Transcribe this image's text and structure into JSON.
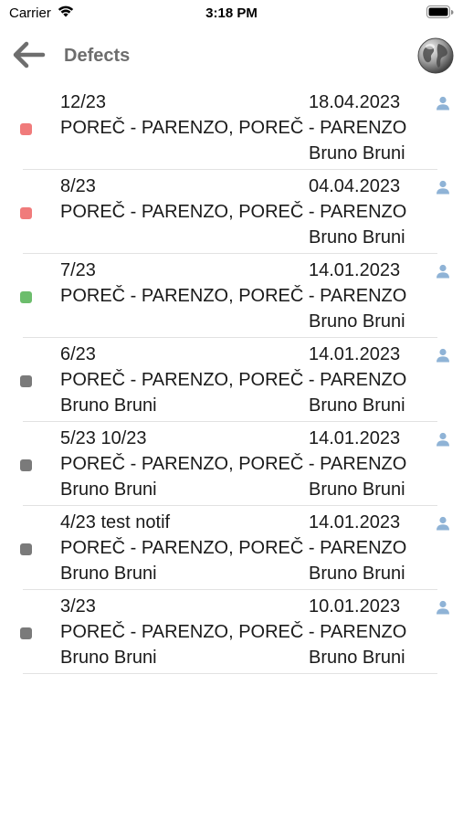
{
  "status_bar": {
    "carrier": "Carrier",
    "time": "3:18 PM"
  },
  "header": {
    "title": "Defects"
  },
  "colors": {
    "red": "#f07b7b",
    "green": "#6cbd6c",
    "gray": "#7a7a7a",
    "user_icon": "#8fb3d6"
  },
  "defects": [
    {
      "number": "12/23",
      "date": "18.04.2023",
      "location": "POREČ - PARENZO, POREČ - PARENZO",
      "left_user": "",
      "right_user": "Bruno Bruni",
      "status": "red"
    },
    {
      "number": "8/23",
      "date": "04.04.2023",
      "location": "POREČ - PARENZO, POREČ - PARENZO",
      "left_user": "",
      "right_user": "Bruno Bruni",
      "status": "red"
    },
    {
      "number": "7/23",
      "date": "14.01.2023",
      "location": "POREČ - PARENZO, POREČ - PARENZO",
      "left_user": "",
      "right_user": "Bruno Bruni",
      "status": "green"
    },
    {
      "number": "6/23",
      "date": "14.01.2023",
      "location": "POREČ - PARENZO, POREČ - PARENZO",
      "left_user": "Bruno Bruni",
      "right_user": "Bruno Bruni",
      "status": "gray"
    },
    {
      "number": "5/23 10/23",
      "date": "14.01.2023",
      "location": "POREČ - PARENZO, POREČ - PARENZO",
      "left_user": "Bruno Bruni",
      "right_user": "Bruno Bruni",
      "status": "gray"
    },
    {
      "number": "4/23 test notif",
      "date": "14.01.2023",
      "location": "POREČ - PARENZO, POREČ - PARENZO",
      "left_user": "Bruno Bruni",
      "right_user": "Bruno Bruni",
      "status": "gray"
    },
    {
      "number": "3/23",
      "date": "10.01.2023",
      "location": "POREČ - PARENZO, POREČ - PARENZO",
      "left_user": "Bruno Bruni",
      "right_user": "Bruno Bruni",
      "status": "gray"
    }
  ]
}
